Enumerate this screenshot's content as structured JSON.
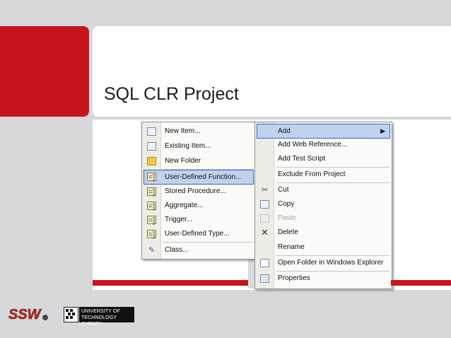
{
  "slide": {
    "title": "SQL CLR Project"
  },
  "left_menu": {
    "items": [
      {
        "label": "New Item...",
        "icon": "new-item-icon"
      },
      {
        "label": "Existing Item...",
        "icon": "existing-item-icon"
      },
      {
        "label": "New Folder",
        "icon": "folder-icon"
      },
      {
        "label": "User-Defined Function...",
        "icon": "code-file-icon",
        "highlighted": true
      },
      {
        "label": "Stored Procedure...",
        "icon": "code-file-icon"
      },
      {
        "label": "Aggregate...",
        "icon": "code-file-icon"
      },
      {
        "label": "Trigger...",
        "icon": "code-file-icon"
      },
      {
        "label": "User-Defined Type...",
        "icon": "code-file-icon"
      },
      {
        "label": "Class...",
        "icon": "class-icon"
      }
    ]
  },
  "right_menu": {
    "items": [
      {
        "label": "Add",
        "highlighted": true,
        "submenu": true
      },
      {
        "label": "Add Web Reference..."
      },
      {
        "label": "Add Test Script"
      },
      {
        "label": "Exclude From Project"
      },
      {
        "label": "Cut",
        "icon": "scissors-icon"
      },
      {
        "label": "Copy",
        "icon": "copy-icon"
      },
      {
        "label": "Paste",
        "icon": "paste-icon",
        "disabled": true
      },
      {
        "label": "Delete",
        "icon": "delete-icon"
      },
      {
        "label": "Rename"
      },
      {
        "label": "Open Folder in Windows Explorer",
        "icon": "open-folder-icon"
      },
      {
        "label": "Properties",
        "icon": "properties-icon"
      }
    ]
  },
  "footer": {
    "ssw_logo": "SSW",
    "uts_logo_line1": "UNIVERSITY OF",
    "uts_logo_line2": "TECHNOLOGY SYDNEY"
  },
  "colors": {
    "accent_red": "#c8141d",
    "menu_highlight": "#c1d2ee",
    "menu_highlight_border": "#316ac5"
  }
}
